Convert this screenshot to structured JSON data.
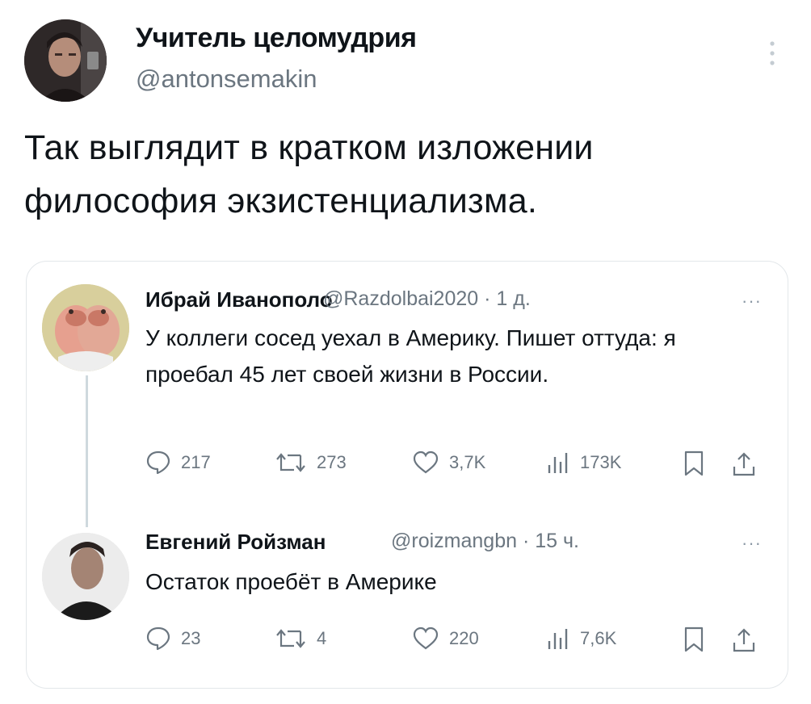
{
  "tweet": {
    "author_name": "Учитель целомудрия",
    "author_handle": "@antonsemakin",
    "text": "Так выглядит в кратком изложении философия экзистенциализма."
  },
  "thread": [
    {
      "name": "Ибрай Иванополо",
      "handle": "@Razdolbai2020",
      "time": "· 1 д.",
      "text": "У коллеги сосед уехал в Америку.  Пишет оттуда: я проебал 45 лет своей жизни в России.",
      "replies": "217",
      "retweets": "273",
      "likes": "3,7K",
      "views": "173K"
    },
    {
      "name": "Евгений Ройзман",
      "handle": "@roizmangbn",
      "time": "· 15 ч.",
      "text": "Остаток проебёт в Америке",
      "replies": "23",
      "retweets": "4",
      "likes": "220",
      "views": "7,6K"
    }
  ],
  "more_label": "···",
  "icons": {
    "reply": "reply-icon",
    "retweet": "retweet-icon",
    "like": "heart-icon",
    "views": "views-icon",
    "bookmark": "bookmark-icon",
    "share": "share-icon",
    "more": "more-icon"
  },
  "colors": {
    "text": "#0f1419",
    "secondary": "#6b7680",
    "border": "#e3e7ea"
  }
}
